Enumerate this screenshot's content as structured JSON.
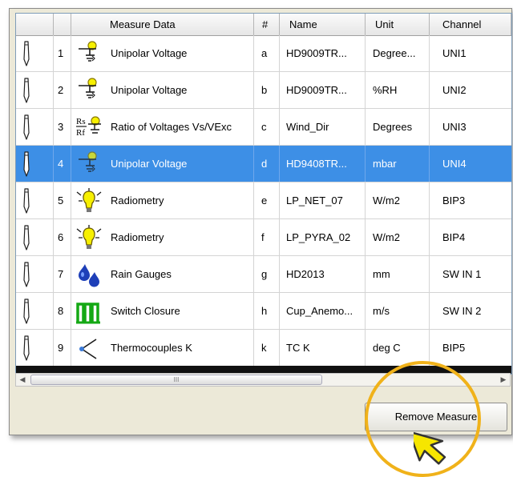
{
  "table": {
    "headers": {
      "measure_data": "Measure Data",
      "hash": "#",
      "name": "Name",
      "unit": "Unit",
      "channel": "Channel"
    },
    "rows": [
      {
        "num": "1",
        "measure": "Unipolar Voltage",
        "letter": "a",
        "name": "HD9009TR...",
        "unit": "Degree...",
        "channel": "UNI1",
        "icon": "unipolar-voltage-icon",
        "selected": false
      },
      {
        "num": "2",
        "measure": "Unipolar Voltage",
        "letter": "b",
        "name": "HD9009TR...",
        "unit": "%RH",
        "channel": "UNI2",
        "icon": "unipolar-voltage-icon",
        "selected": false
      },
      {
        "num": "3",
        "measure": "Ratio of Voltages Vs/VExc",
        "letter": "c",
        "name": "Wind_Dir",
        "unit": "Degrees",
        "channel": "UNI3",
        "icon": "ratio-voltages-icon",
        "selected": false
      },
      {
        "num": "4",
        "measure": "Unipolar Voltage",
        "letter": "d",
        "name": "HD9408TR...",
        "unit": "mbar",
        "channel": "UNI4",
        "icon": "unipolar-voltage-icon",
        "selected": true
      },
      {
        "num": "5",
        "measure": "Radiometry",
        "letter": "e",
        "name": "LP_NET_07",
        "unit": "W/m2",
        "channel": "BIP3",
        "icon": "radiometry-bulb-icon",
        "selected": false
      },
      {
        "num": "6",
        "measure": "Radiometry",
        "letter": "f",
        "name": "LP_PYRA_02",
        "unit": "W/m2",
        "channel": "BIP4",
        "icon": "radiometry-bulb-icon",
        "selected": false
      },
      {
        "num": "7",
        "measure": "Rain Gauges",
        "letter": "g",
        "name": "HD2013",
        "unit": "mm",
        "channel": "SW IN 1",
        "icon": "rain-drops-icon",
        "selected": false
      },
      {
        "num": "8",
        "measure": "Switch Closure",
        "letter": "h",
        "name": "Cup_Anemo...",
        "unit": "m/s",
        "channel": "SW IN 2",
        "icon": "switch-closure-icon",
        "selected": false
      },
      {
        "num": "9",
        "measure": "Thermocouples K",
        "letter": "k",
        "name": "TC K",
        "unit": "deg C",
        "channel": "BIP5",
        "icon": "thermocouple-icon",
        "selected": false
      }
    ]
  },
  "scrollbar": {
    "thumb_grip": "III"
  },
  "actions": {
    "remove_measure_label": "Remove Measure"
  },
  "colors": {
    "selection": "#3d8fe6",
    "highlight_ring": "#f0b21a",
    "cursor_fill": "#f6e600"
  }
}
